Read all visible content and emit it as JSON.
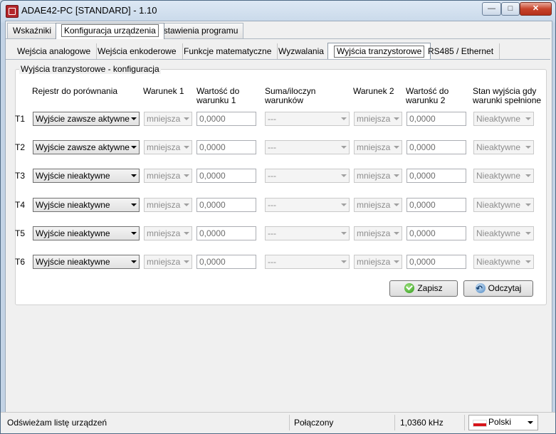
{
  "window": {
    "title": "ADAE42-PC [STANDARD] - 1.10",
    "minimize": "—",
    "maximize": "□",
    "close": "✕"
  },
  "main_tabs": [
    "Wskaźniki",
    "Konfiguracja urządzenia",
    "Ustawienia programu"
  ],
  "sub_tabs": [
    "Wejścia analogowe",
    "Wejścia enkoderowe",
    "Funkcje matematyczne",
    "Wyzwalania",
    "Wyjścia tranzystorowe",
    "RS485 / Ethernet"
  ],
  "group_title": "Wyjścia tranzystorowe - konfiguracja",
  "headers": {
    "register": "Rejestr do porównania",
    "cond1": "Warunek 1",
    "val1_a": "Wartość do",
    "val1_b": "warunku 1",
    "sum_a": "Suma/iloczyn",
    "sum_b": "warunków",
    "cond2": "Warunek 2",
    "val2_a": "Wartość do",
    "val2_b": "warunku 2",
    "state_a": "Stan wyjścia gdy",
    "state_b": "warunki spełnione"
  },
  "rows": [
    {
      "label": "T1",
      "register": "Wyjście zawsze aktywne",
      "cond1": "mniejsza",
      "val1": "0,0000",
      "sum": "---",
      "cond2": "mniejsza",
      "val2": "0,0000",
      "state": "Nieaktywne"
    },
    {
      "label": "T2",
      "register": "Wyjście zawsze aktywne",
      "cond1": "mniejsza",
      "val1": "0,0000",
      "sum": "---",
      "cond2": "mniejsza",
      "val2": "0,0000",
      "state": "Nieaktywne"
    },
    {
      "label": "T3",
      "register": "Wyjście nieaktywne",
      "cond1": "mniejsza",
      "val1": "0,0000",
      "sum": "---",
      "cond2": "mniejsza",
      "val2": "0,0000",
      "state": "Nieaktywne"
    },
    {
      "label": "T4",
      "register": "Wyjście nieaktywne",
      "cond1": "mniejsza",
      "val1": "0,0000",
      "sum": "---",
      "cond2": "mniejsza",
      "val2": "0,0000",
      "state": "Nieaktywne"
    },
    {
      "label": "T5",
      "register": "Wyjście nieaktywne",
      "cond1": "mniejsza",
      "val1": "0,0000",
      "sum": "---",
      "cond2": "mniejsza",
      "val2": "0,0000",
      "state": "Nieaktywne"
    },
    {
      "label": "T6",
      "register": "Wyjście nieaktywne",
      "cond1": "mniejsza",
      "val1": "0,0000",
      "sum": "---",
      "cond2": "mniejsza",
      "val2": "0,0000",
      "state": "Nieaktywne"
    }
  ],
  "buttons": {
    "save": "Zapisz",
    "read": "Odczytaj"
  },
  "status": {
    "message": "Odświeżam listę urządzeń",
    "connection": "Połączony",
    "frequency": "1,0360 kHz",
    "language": "Polski"
  }
}
